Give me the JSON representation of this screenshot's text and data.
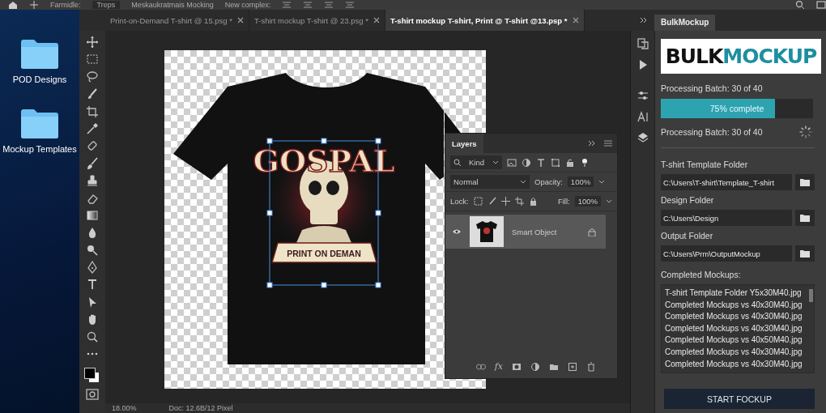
{
  "options_bar": {
    "items": [
      "Farmidle:",
      "Treps",
      "Meskaukratmais Mocking",
      "New complex:"
    ]
  },
  "desktop": {
    "icons": [
      {
        "label": "POD Designs"
      },
      {
        "label": "Mockup Templates"
      }
    ]
  },
  "document_tabs": [
    {
      "title": "Print-on-Demand T-shirt @ 15.psg *",
      "selected": false
    },
    {
      "title": "T-shirt mockup T-shirt @ 23.psg *",
      "selected": false
    },
    {
      "title": "T-shirt mockup T-shirt, Print @ T-shirt @13.psp *",
      "selected": true
    }
  ],
  "canvas": {
    "design": {
      "title": "GOSPAL",
      "banner": "PRINT ON DEMAN"
    }
  },
  "layers_panel": {
    "title": "Layers",
    "filter": "Kind",
    "blend_mode": "Normal",
    "opacity_label": "Opacity:",
    "opacity": "100%",
    "lock_label": "Lock:",
    "fill_label": "Fill:",
    "fill": "100%",
    "fx_label": "fx",
    "layers": [
      {
        "name": "Smart Object",
        "visible": true,
        "selected": true
      }
    ]
  },
  "bulk_mockup": {
    "tab": "BulkMockup",
    "logo": [
      "BULK",
      "MOCKUP"
    ],
    "status_top": "Processing Batch: 30 of 40",
    "progress": {
      "level": 0.75,
      "label": "75% complete"
    },
    "status": "Processing Batch: 30 of 40",
    "fields": [
      {
        "label": "T-shirt Template Folder",
        "value": "C:\\Users\\T-shirt\\Template_T-shirt"
      },
      {
        "label": "Design Folder",
        "value": "C:\\Users\\Design"
      },
      {
        "label": "Output Folder",
        "value": "C:\\Users\\Prm\\OutputMockup"
      }
    ],
    "completed_label": "Completed Mockups:",
    "completed": [
      "T-shirt Template Folder Y5x30M40.jpg",
      "Completed Mockups vs 40x30M40.jpg",
      "Completed Mockups vs 40x30M40.jpg",
      "Completed Mockups vs 40x30M40.jpg",
      "Completed Mockups vs 40x50M40.jpg",
      "Completed Mockups vs 40x30M40.jpg",
      "Completed Mockups vs 40x30M40.jpg"
    ],
    "button": "START FOCKUP"
  },
  "status_bar": {
    "zoom": "18.00%",
    "doc": "Doc: 12.6B/12 Pixel"
  }
}
